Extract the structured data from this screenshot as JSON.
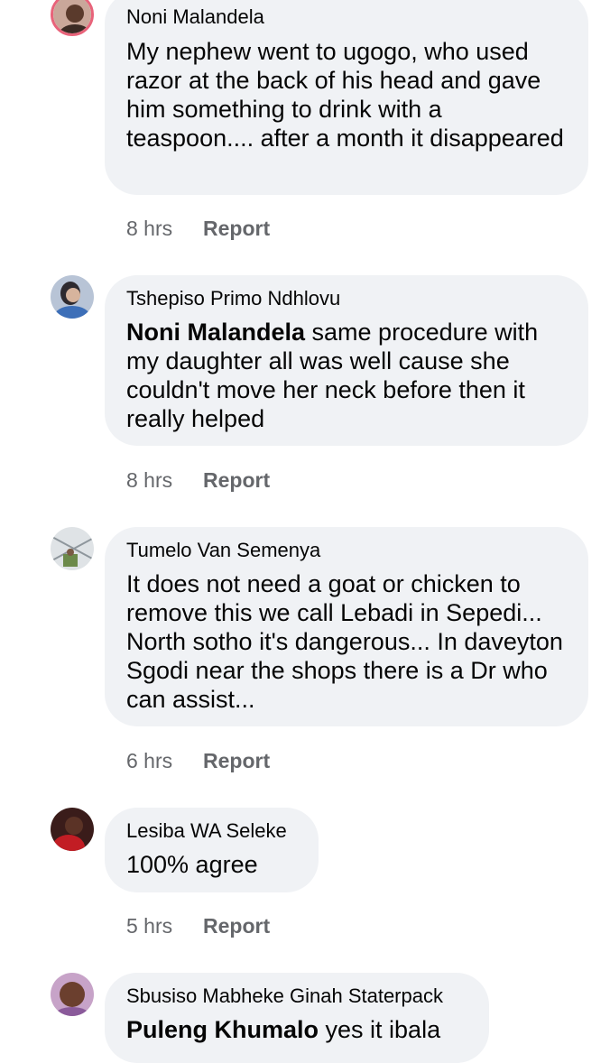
{
  "comments": [
    {
      "author": "Noni Malandela",
      "mention": "",
      "text": "My nephew went to ugogo, who used razor at the back of his head and gave him something to drink with a teaspoon.... after a month it disappeared",
      "time": "8 hrs",
      "report_label": "Report"
    },
    {
      "author": "Tshepiso Primo Ndhlovu",
      "mention": "Noni Malandela",
      "text": " same procedure with my daughter all was well cause she couldn't move her neck before then it really helped",
      "time": "8 hrs",
      "report_label": "Report"
    },
    {
      "author": "Tumelo Van Semenya",
      "mention": "",
      "text": "It does not need a goat or chicken to remove this we call Lebadi in Sepedi... North sotho it's dangerous... In daveyton Sgodi near the shops there is a Dr who can assist...",
      "time": "6 hrs",
      "report_label": "Report"
    },
    {
      "author": "Lesiba WA Seleke",
      "mention": "",
      "text": "100% agree",
      "time": "5 hrs",
      "report_label": "Report"
    },
    {
      "author": "Sbusiso Mabheke Ginah Staterpack",
      "mention": "Puleng Khumalo",
      "text": " yes it ibala",
      "time": "",
      "report_label": ""
    }
  ],
  "colors": {
    "bubble_bg": "#f0f2f5",
    "meta_text": "#65676b",
    "body_text": "#050505"
  }
}
